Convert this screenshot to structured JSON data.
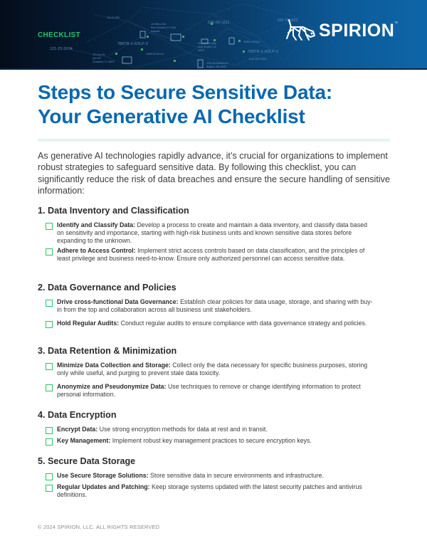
{
  "header": {
    "tag": "CHECKLIST",
    "brand": "SPIRION",
    "brand_tm": "™",
    "background_codes": [
      "123-45-6789",
      "16 Clifton Cres",
      "Park Orchards VIC 3128",
      "Australia",
      "036-9X-1111",
      "788TR-1-XOLP-3",
      "121-23-3X34",
      "28 Cheyenne Way",
      "Corte Madera, CA",
      "94925",
      "4028XL-5200A3",
      "78 Corey Rd",
      "Apt 24R",
      "Charleston, FL 18576",
      "29189-52-9XVJ-6",
      "2028 NW Baseline Dr",
      "Brighton, MA 02615",
      "DOO-38FR-88X3",
      "036-75-6422"
    ],
    "colors": {
      "tag": "#27c46a",
      "brand": "#ffffff",
      "gradient_start": "#040d1a",
      "gradient_end": "#0e66a8"
    }
  },
  "title": {
    "line1": "Steps to Secure Sensitive Data:",
    "line2": "Your Generative AI Checklist",
    "color": "#0a68b0"
  },
  "intro": "As generative AI technologies rapidly advance, it’s crucial for organizations to implement robust strategies to safeguard sensitive data. By following this checklist, you can significantly reduce the risk of data breaches and ensure the secure handling of sensitive information:",
  "sections": [
    {
      "title": "1. Data Inventory and Classification",
      "items": [
        {
          "label": "Identify and Classify Data:",
          "text": " Develop a process to create and maintain a data inventory, and classify data based on sensitivity and importance, starting with high-risk business units and known sensitive data stores before expanding to the unknown.",
          "checked": false
        },
        {
          "label": "Adhere to Access Control:",
          "text": " Implement strict access controls based on data classification, and the principles of least privilege and business need-to-know. Ensure only authorized personnel can access sensitive data.",
          "checked": false
        }
      ]
    },
    {
      "title": "2. Data Governance and Policies",
      "items": [
        {
          "label": "Drive cross-functional Data Governance:",
          "text": " Establish clear policies for data usage, storage, and sharing with buy-in from the top and collaboration across all business unit stakeholders.",
          "checked": false
        },
        {
          "label": "Hold Regular Audits:",
          "text": " Conduct regular audits to ensure compliance with data governance strategy and policies.",
          "checked": false
        }
      ]
    },
    {
      "title": "3. Data Retention & Minimization",
      "items": [
        {
          "label": "Minimize Data Collection and Storage:",
          "text": " Collect only the data necessary for specific business purposes, storing only while useful, and purging to prevent stale data toxicity.",
          "checked": false
        },
        {
          "label": "Anonymize and Pseudonymize Data:",
          "text": " Use techniques to remove or change identifying information to protect personal information.",
          "checked": false
        }
      ]
    },
    {
      "title": "4. Data Encryption",
      "items": [
        {
          "label": "Encrypt Data:",
          "text": " Use strong encryption methods for data at rest and in transit.",
          "checked": false
        },
        {
          "label": "Key Management:",
          "text": " Implement robust key management practices to secure encryption keys.",
          "checked": false
        }
      ]
    },
    {
      "title": "5. Secure Data Storage",
      "items": [
        {
          "label": "Use Secure Storage Solutions:",
          "text": " Store sensitive data in secure environments and infrastructure.",
          "checked": false
        },
        {
          "label": "Regular Updates and Patching:",
          "text": " Keep storage systems updated with the latest security patches and antivirus definitions.",
          "checked": false
        }
      ]
    }
  ],
  "footer": "© 2024 SPIRION, LLC. ALL RIGHTS RESERVED",
  "accent_colors": {
    "checkbox": "#27c46a",
    "divider": "#e8f3ef"
  }
}
